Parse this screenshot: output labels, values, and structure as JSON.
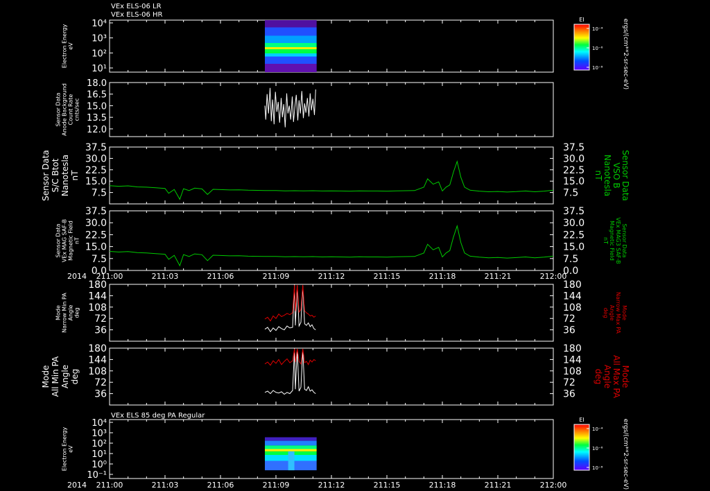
{
  "header": {
    "line1": "VEx ELS-06 LR",
    "line2": "VEx ELS-06 HR"
  },
  "mid_header": "VEx ELS 85 deg PA Regular",
  "year_label": "2014",
  "colors": {
    "background": "#000000",
    "axis": "#ffffff",
    "green": "#00cc00",
    "red": "#dd0000"
  },
  "x_axis": {
    "start": "211:00",
    "end": "212:00",
    "ticks": [
      "211:00",
      "211:03",
      "211:06",
      "211:09",
      "211:12",
      "211:15",
      "211:18",
      "211:21",
      "212:00"
    ]
  },
  "colorbar": {
    "label": "EI",
    "units": "ergs/(cm**2-sr-sec-eV)",
    "tick_labels": [
      "10⁻⁴",
      "10⁻⁶",
      "10⁻⁸"
    ]
  },
  "chart_data": [
    {
      "type": "heatmap",
      "ylabel": [
        "Electron Energy",
        "eV"
      ],
      "y_tick_labels": [
        "10⁴",
        "10³",
        "10²",
        "10¹"
      ],
      "y_scale": "log",
      "data_span": [
        "211:08.4",
        "211:11.2"
      ]
    },
    {
      "type": "line",
      "ylabel": [
        "Sensor Data",
        "Anode Background",
        "Count Rate",
        "cnts/sec"
      ],
      "y_tick_labels": [
        "18.0",
        "16.5",
        "15.0",
        "13.5",
        "12.0"
      ],
      "ylim": [
        11,
        18
      ],
      "series": [
        {
          "color": "#ffffff",
          "x": [
            8.4,
            8.45,
            8.52,
            8.6,
            8.68,
            8.75,
            8.82,
            8.9,
            8.97,
            9.05,
            9.12,
            9.2,
            9.28,
            9.35,
            9.42,
            9.5,
            9.58,
            9.65,
            9.72,
            9.8,
            9.88,
            9.95,
            10.02,
            10.1,
            10.18,
            10.25,
            10.32,
            10.4,
            10.48,
            10.55,
            10.62,
            10.7,
            10.78,
            10.85,
            10.92,
            11.0,
            11.08,
            11.15
          ],
          "y": [
            15.0,
            13.2,
            16.5,
            14.0,
            17.3,
            13.0,
            15.8,
            12.6,
            16.8,
            14.2,
            15.5,
            12.8,
            16.0,
            13.5,
            15.2,
            12.2,
            16.6,
            14.0,
            15.0,
            13.2,
            16.2,
            12.9,
            14.8,
            16.4,
            13.1,
            15.7,
            14.0,
            16.9,
            13.4,
            15.3,
            14.1,
            16.0,
            13.6,
            16.6,
            14.4,
            15.9,
            13.8,
            17.1
          ]
        }
      ]
    },
    {
      "type": "line",
      "ylabel": [
        "Sensor Data",
        "S/C Btot",
        "Nanotesla",
        "nT"
      ],
      "right_label": [
        "Sensor Data",
        "VSO B",
        "Nanotesla",
        "nT"
      ],
      "y_tick_labels": [
        "37.5",
        "30.0",
        "22.5",
        "15.0",
        "7.5"
      ],
      "ylim": [
        0,
        37.5
      ],
      "series": [
        {
          "color": "#00cc00",
          "x": [
            0.0,
            0.5,
            1.0,
            1.5,
            2.0,
            2.5,
            3.0,
            3.2,
            3.5,
            3.8,
            4.0,
            4.3,
            4.6,
            5.0,
            5.3,
            5.6,
            6.0,
            6.5,
            7.0,
            7.5,
            8.0,
            8.5,
            9.0,
            9.5,
            10.0,
            10.5,
            11.0,
            11.5,
            12.0,
            12.5,
            13.0,
            13.5,
            14.0,
            14.5,
            15.0,
            15.5,
            16.0,
            16.5,
            17.0,
            17.2,
            17.5,
            17.8,
            18.0,
            18.2,
            18.4,
            18.6,
            18.8,
            19.0,
            19.2,
            19.5,
            20.0,
            20.5,
            21.0,
            21.5,
            22.0,
            22.5,
            23.0,
            23.5,
            24.0
          ],
          "y": [
            12.0,
            11.6,
            11.9,
            11.2,
            11.0,
            10.6,
            10.2,
            7.0,
            9.5,
            3.0,
            10.0,
            8.8,
            10.4,
            9.9,
            6.2,
            9.6,
            9.4,
            9.2,
            9.3,
            9.0,
            8.9,
            8.8,
            8.8,
            8.6,
            8.7,
            8.6,
            8.7,
            8.5,
            8.6,
            8.5,
            8.4,
            8.6,
            8.5,
            8.5,
            8.4,
            8.6,
            8.7,
            8.8,
            11.0,
            16.5,
            13.0,
            14.5,
            8.5,
            11.0,
            12.5,
            21.0,
            28.0,
            17.5,
            11.0,
            9.0,
            8.4,
            8.0,
            8.2,
            7.8,
            8.1,
            8.5,
            8.0,
            8.4,
            9.0
          ]
        }
      ]
    },
    {
      "type": "line",
      "ylabel": [
        "Sensor Data",
        "VEx MAG SAF-B",
        "Magnetic Field",
        "nT"
      ],
      "right_label": [
        "Sensor Data",
        "VEx MAG3 SAF-B",
        "Magnetic Field",
        "nT"
      ],
      "y_tick_labels": [
        "37.5",
        "30.0",
        "22.5",
        "15.0",
        "7.5",
        "0.0"
      ],
      "ylim": [
        0,
        37.5
      ],
      "series": [
        {
          "color": "#00cc00",
          "x": [
            0.0,
            0.5,
            1.0,
            1.5,
            2.0,
            2.5,
            3.0,
            3.2,
            3.5,
            3.8,
            4.0,
            4.3,
            4.6,
            5.0,
            5.3,
            5.6,
            6.0,
            6.5,
            7.0,
            7.5,
            8.0,
            8.5,
            9.0,
            9.5,
            10.0,
            10.5,
            11.0,
            11.5,
            12.0,
            12.5,
            13.0,
            13.5,
            14.0,
            14.5,
            15.0,
            15.5,
            16.0,
            16.5,
            17.0,
            17.2,
            17.5,
            17.8,
            18.0,
            18.2,
            18.4,
            18.6,
            18.8,
            19.0,
            19.2,
            19.5,
            20.0,
            20.5,
            21.0,
            21.5,
            22.0,
            22.5,
            23.0,
            23.5,
            24.0
          ],
          "y": [
            12.0,
            11.6,
            11.9,
            11.2,
            11.0,
            10.6,
            10.2,
            7.0,
            9.5,
            3.0,
            10.0,
            8.8,
            10.4,
            9.9,
            6.2,
            9.6,
            9.4,
            9.2,
            9.3,
            9.0,
            8.9,
            8.8,
            8.8,
            8.6,
            8.7,
            8.6,
            8.7,
            8.5,
            8.6,
            8.5,
            8.4,
            8.6,
            8.5,
            8.5,
            8.4,
            8.6,
            8.7,
            8.8,
            11.0,
            16.5,
            13.0,
            14.5,
            8.5,
            11.0,
            12.5,
            21.0,
            28.0,
            17.5,
            11.0,
            9.0,
            8.4,
            8.0,
            8.2,
            7.8,
            8.1,
            8.5,
            8.0,
            8.4,
            9.0
          ]
        }
      ]
    },
    {
      "type": "line",
      "ylabel": [
        "Mode",
        "Narrow Min PA",
        "Angle",
        "deg"
      ],
      "right_label": [
        "Mode",
        "Narrow Max PA",
        "Angle",
        "deg"
      ],
      "y_tick_labels": [
        "180",
        "144",
        "108",
        "72",
        "36"
      ],
      "ylim": [
        0,
        180
      ],
      "series": [
        {
          "color": "#ffffff",
          "x": [
            8.4,
            8.55,
            8.7,
            8.85,
            9.0,
            9.15,
            9.3,
            9.45,
            9.6,
            9.75,
            9.9,
            10.0,
            10.05,
            10.15,
            10.25,
            10.35,
            10.45,
            10.55,
            10.65,
            10.75,
            10.85,
            10.95,
            11.05,
            11.15
          ],
          "y": [
            38,
            44,
            30,
            42,
            34,
            46,
            40,
            36,
            48,
            42,
            44,
            175,
            50,
            175,
            48,
            60,
            175,
            55,
            50,
            58,
            46,
            52,
            40,
            36
          ]
        },
        {
          "color": "#dd0000",
          "x": [
            8.4,
            8.55,
            8.7,
            8.85,
            9.0,
            9.15,
            9.3,
            9.45,
            9.6,
            9.75,
            9.9,
            10.0,
            10.05,
            10.15,
            10.25,
            10.35,
            10.45,
            10.55,
            10.65,
            10.75,
            10.85,
            10.95,
            11.05,
            11.15
          ],
          "y": [
            70,
            76,
            64,
            80,
            72,
            86,
            78,
            82,
            88,
            84,
            90,
            178,
            95,
            178,
            92,
            100,
            178,
            96,
            90,
            86,
            80,
            82,
            76,
            80
          ]
        }
      ]
    },
    {
      "type": "line",
      "ylabel": [
        "Mode",
        "All Min PA",
        "Angle",
        "deg"
      ],
      "right_label": [
        "Mode",
        "All Max PA",
        "Angle",
        "deg"
      ],
      "y_tick_labels": [
        "180",
        "144",
        "108",
        "72",
        "36"
      ],
      "ylim": [
        0,
        180
      ],
      "series": [
        {
          "color": "#ffffff",
          "x": [
            8.4,
            8.55,
            8.7,
            8.85,
            9.0,
            9.15,
            9.3,
            9.45,
            9.6,
            9.75,
            9.9,
            10.0,
            10.05,
            10.15,
            10.25,
            10.35,
            10.45,
            10.55,
            10.65,
            10.75,
            10.85,
            10.95,
            11.05,
            11.15
          ],
          "y": [
            40,
            44,
            36,
            46,
            40,
            38,
            42,
            34,
            40,
            36,
            46,
            175,
            50,
            175,
            44,
            56,
            175,
            50,
            46,
            58,
            44,
            48,
            40,
            36
          ]
        },
        {
          "color": "#dd0000",
          "x": [
            8.4,
            8.55,
            8.7,
            8.85,
            9.0,
            9.15,
            9.3,
            9.45,
            9.6,
            9.75,
            9.9,
            10.0,
            10.05,
            10.15,
            10.25,
            10.35,
            10.45,
            10.55,
            10.65,
            10.75,
            10.85,
            10.95,
            11.05,
            11.15
          ],
          "y": [
            130,
            136,
            126,
            140,
            132,
            144,
            128,
            138,
            146,
            134,
            140,
            178,
            136,
            178,
            138,
            130,
            178,
            134,
            138,
            128,
            142,
            136,
            144,
            140
          ]
        }
      ]
    },
    {
      "type": "heatmap",
      "ylabel": [
        "Electron Energy",
        "eV"
      ],
      "y_tick_labels": [
        "10⁴",
        "10³",
        "10²",
        "10¹",
        "10⁰",
        "10⁻¹"
      ],
      "y_scale": "log",
      "data_span": [
        "211:08.4",
        "211:11.2"
      ]
    }
  ]
}
